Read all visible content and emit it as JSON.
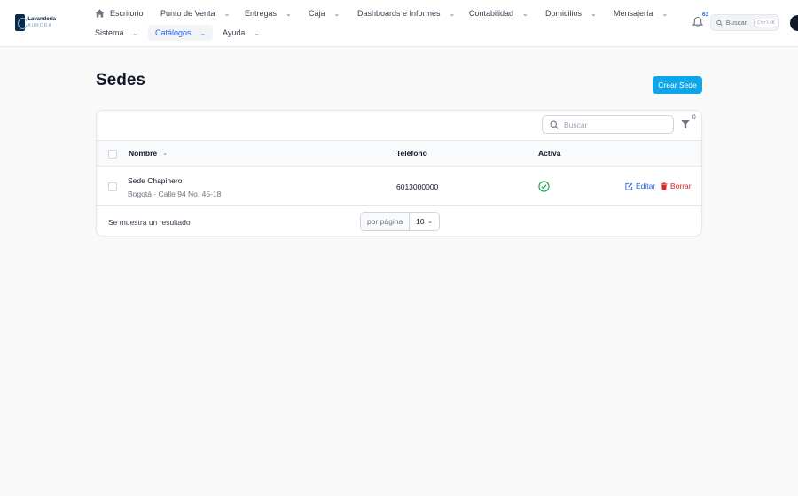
{
  "brand": {
    "line1": "Lavandería",
    "line2": "AURORA"
  },
  "nav": {
    "row1": [
      {
        "label": "Escritorio",
        "has_menu": false
      },
      {
        "label": "Punto de Venta",
        "has_menu": true
      },
      {
        "label": "Entregas",
        "has_menu": true
      },
      {
        "label": "Caja",
        "has_menu": true
      },
      {
        "label": "Dashboards e Informes",
        "has_menu": true
      },
      {
        "label": "Contabilidad",
        "has_menu": true
      },
      {
        "label": "Domicilios",
        "has_menu": true
      },
      {
        "label": "Mensajería",
        "has_menu": true
      }
    ],
    "row2": [
      {
        "label": "Sistema",
        "has_menu": true
      },
      {
        "label": "Catálogos",
        "has_menu": true,
        "active": true
      },
      {
        "label": "Ayuda",
        "has_menu": true
      }
    ]
  },
  "notifications": {
    "count": "63"
  },
  "global_search": {
    "label": "Buscar",
    "shortcut": "Ctrl+K"
  },
  "page": {
    "title": "Sedes",
    "create_label": "Crear Sede"
  },
  "table": {
    "search_placeholder": "Buscar",
    "filter_count": "0",
    "columns": {
      "name": "Nombre",
      "phone": "Teléfono",
      "active": "Activa"
    },
    "rows": [
      {
        "name": "Sede Chapinero",
        "description": "Bogotá · Calle 94 No. 45-18",
        "phone": "6013000000",
        "active": true,
        "edit_label": "Editar",
        "delete_label": "Borrar"
      }
    ],
    "footer": {
      "summary": "Se muestra un resultado",
      "per_page_label": "por página",
      "per_page_value": "10"
    }
  },
  "colors": {
    "primary": "#2563eb",
    "create_button": "#0ea5e9",
    "danger": "#dc2626",
    "success": "#16a34a"
  }
}
